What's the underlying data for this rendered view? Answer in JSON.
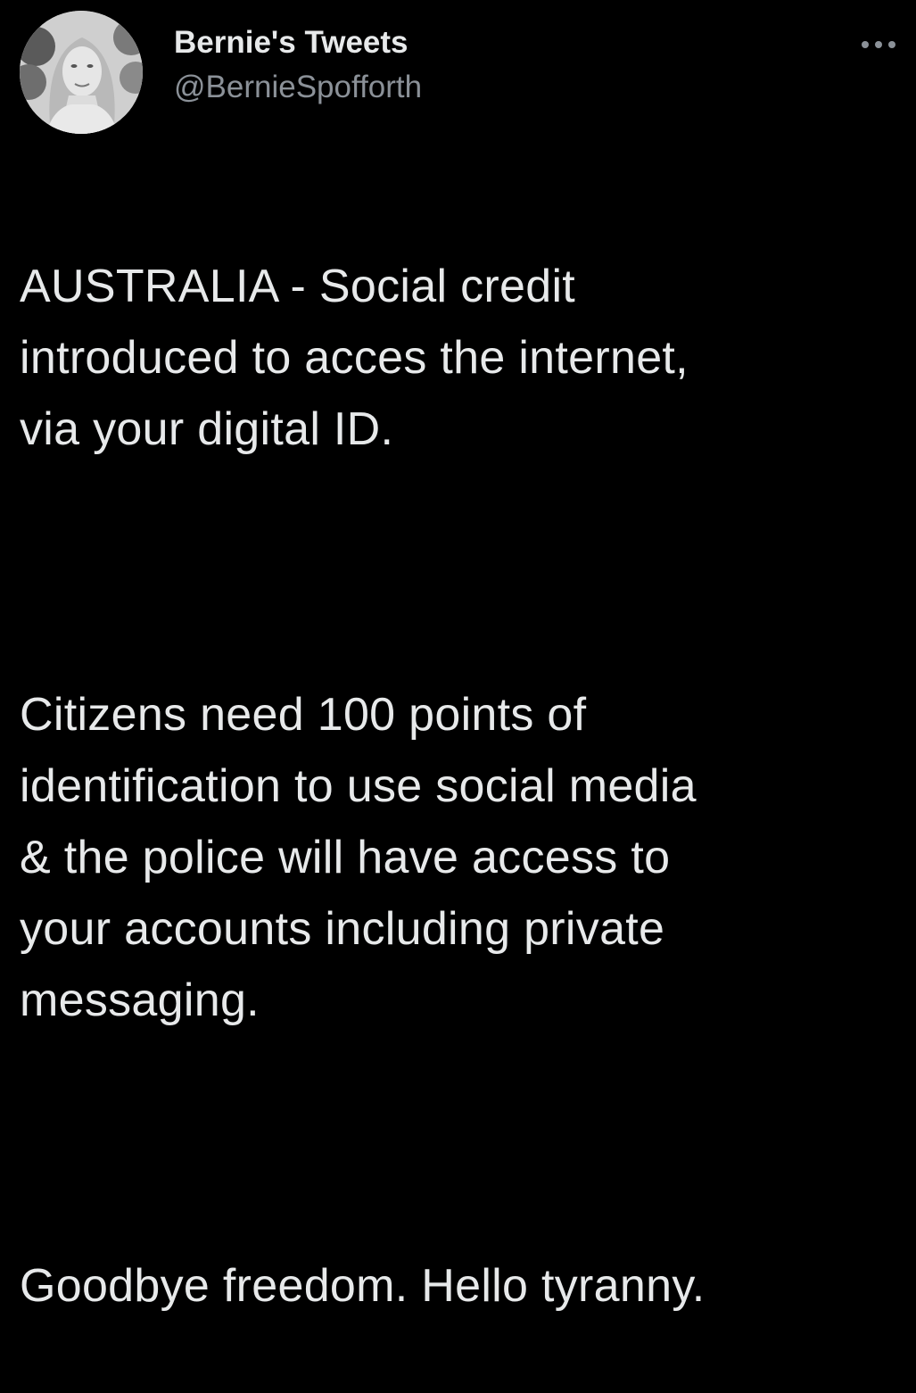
{
  "tweet": {
    "author": {
      "display_name": "Bernie's Tweets",
      "handle": "@BernieSpofforth"
    },
    "more_icon": "more-horizontal-icon",
    "paragraphs": [
      "AUSTRALIA - Social credit\nintroduced to acces the internet,\nvia your digital ID.",
      "Citizens need 100 points of\nidentification to use social media\n& the police will have access to\nyour accounts including private\nmessaging.",
      "Goodbye freedom. Hello tyranny."
    ]
  },
  "colors": {
    "background": "#000000",
    "text_primary": "#e7e9ea",
    "text_secondary": "#8b9198"
  }
}
